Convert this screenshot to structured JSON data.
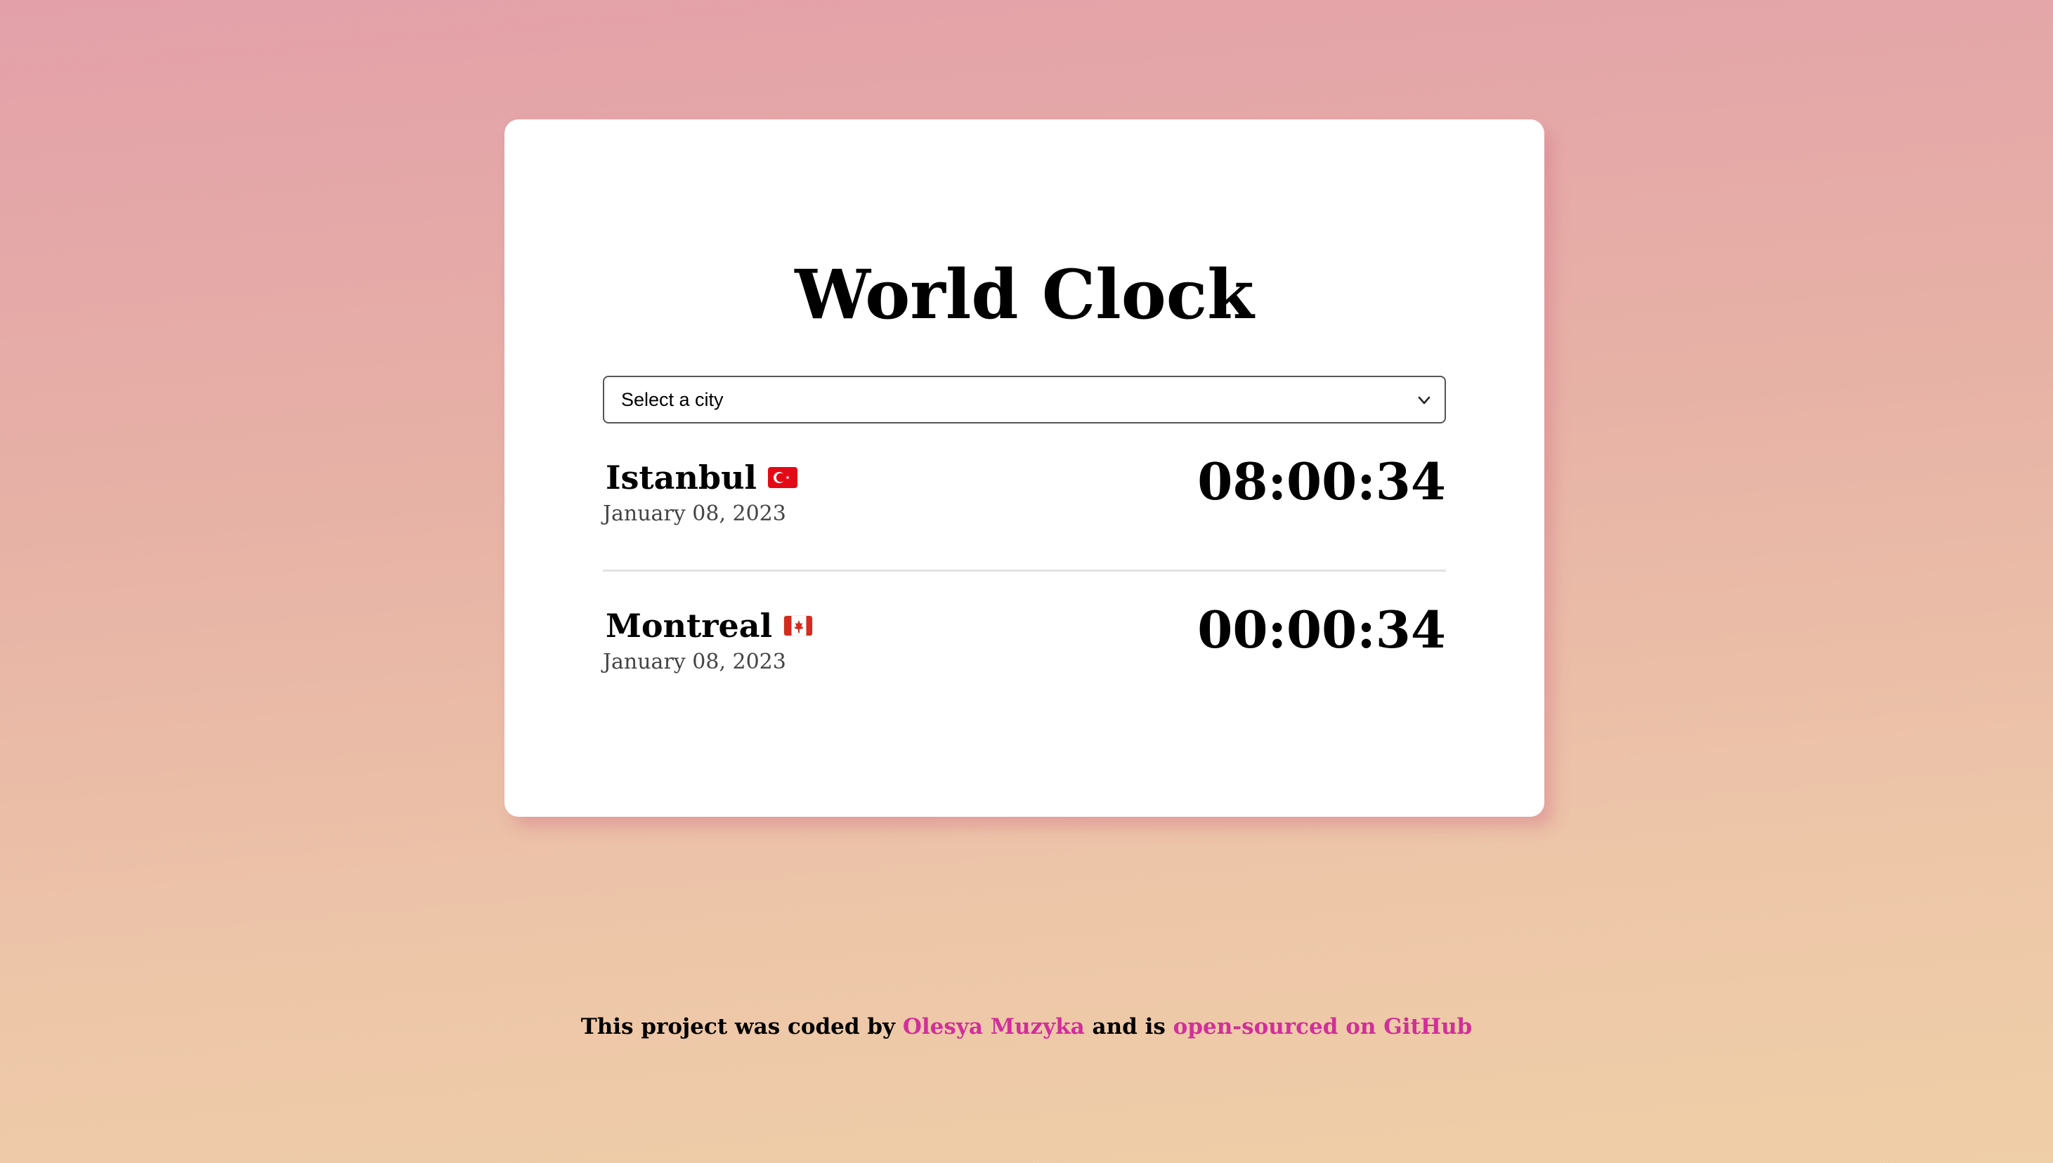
{
  "app": {
    "title": "World Clock"
  },
  "city_select": {
    "selected_label": "Select a city",
    "icon": "chevron-down-icon"
  },
  "cities": [
    {
      "name": "Istanbul",
      "flag": "turkey-flag-icon",
      "date": "January 08, 2023",
      "time": "08:00:34"
    },
    {
      "name": "Montreal",
      "flag": "canada-flag-icon",
      "date": "January 08, 2023",
      "time": "00:00:34"
    }
  ],
  "footer": {
    "prefix": "This project was coded by",
    "author_link": "Olesya Muzyka",
    "middle": "and is",
    "repo_link": "open-sourced on GitHub"
  },
  "colors": {
    "link": "#d12f99",
    "background_top": "#e3a0a9",
    "background_bottom": "#efcfa7",
    "card": "#ffffff"
  }
}
